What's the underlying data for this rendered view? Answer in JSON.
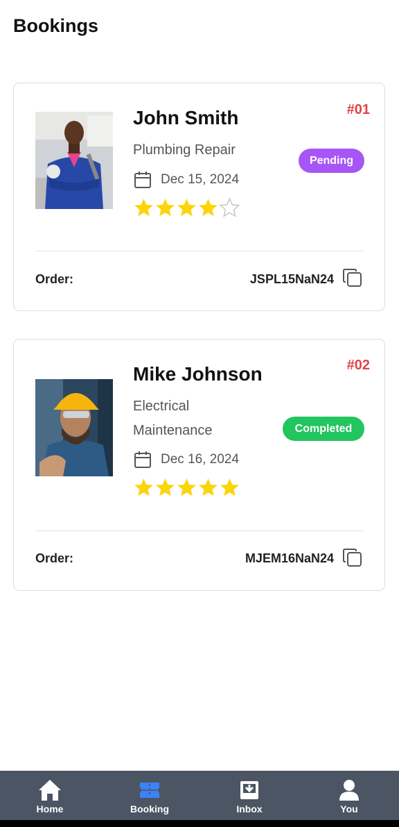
{
  "page": {
    "title": "Bookings"
  },
  "bookings": [
    {
      "name": "John Smith",
      "number": "#01",
      "service": "Plumbing Repair",
      "status": "Pending",
      "status_color": "#a855f7",
      "date": "Dec 15, 2024",
      "rating": 4,
      "rating_max": 5,
      "order_label": "Order:",
      "order_code": "JSPL15NaN24"
    },
    {
      "name": "Mike Johnson",
      "number": "#02",
      "service_line1": "Electrical",
      "service_line2": "Maintenance",
      "status": "Completed",
      "status_color": "#22c55e",
      "date": "Dec 16, 2024",
      "rating": 5,
      "rating_max": 5,
      "order_label": "Order:",
      "order_code": "MJEM16NaN24"
    }
  ],
  "nav": {
    "items": [
      {
        "label": "Home",
        "icon": "home-icon",
        "active": false
      },
      {
        "label": "Booking",
        "icon": "ticket-icon",
        "active": true
      },
      {
        "label": "Inbox",
        "icon": "inbox-icon",
        "active": false
      },
      {
        "label": "You",
        "icon": "user-icon",
        "active": false
      }
    ]
  },
  "colors": {
    "accent_red": "#e04545",
    "star": "#fcd40c",
    "nav_bg": "#4b5563",
    "nav_active": "#3b82f6"
  }
}
